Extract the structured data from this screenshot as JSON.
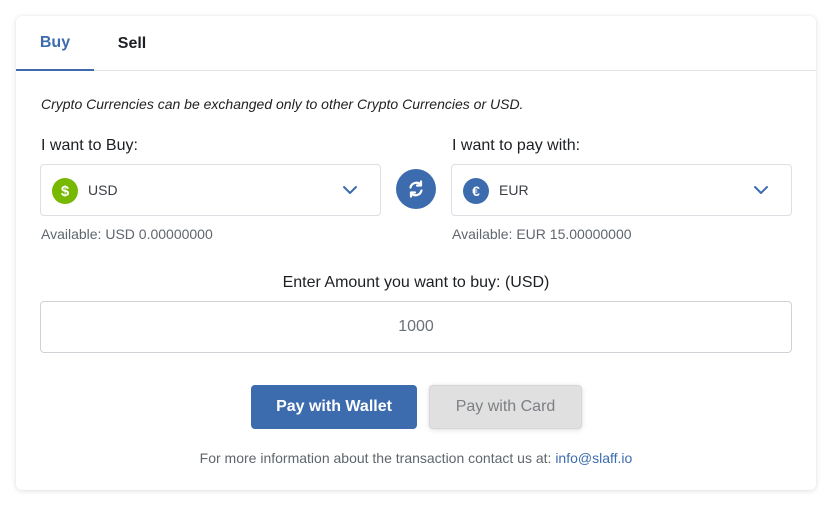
{
  "tabs": [
    {
      "label": "Buy",
      "active": true
    },
    {
      "label": "Sell",
      "active": false
    }
  ],
  "notice": "Crypto Currencies can be exchanged only to other Crypto Currencies or USD.",
  "buy_side": {
    "label": "I want to Buy:",
    "currency": "USD",
    "icon": "dollar-coin-icon",
    "icon_glyph": "$",
    "icon_color": "#77b800",
    "available": "Available: USD 0.00000000"
  },
  "pay_side": {
    "label": "I want to pay with:",
    "currency": "EUR",
    "icon": "euro-coin-icon",
    "icon_glyph": "€",
    "icon_color": "#3d6cae",
    "available": "Available: EUR 15.00000000"
  },
  "swap_icon": "swap-arrows-icon",
  "amount": {
    "label": "Enter Amount you want to buy: (USD)",
    "value": "1000"
  },
  "buttons": {
    "wallet": "Pay with Wallet",
    "card": "Pay with Card"
  },
  "footer": {
    "text": "For more information about the transaction contact us at: ",
    "email": "info@slaff.io"
  },
  "colors": {
    "accent": "#3d6cae",
    "disabled": "#e0e0e0"
  }
}
